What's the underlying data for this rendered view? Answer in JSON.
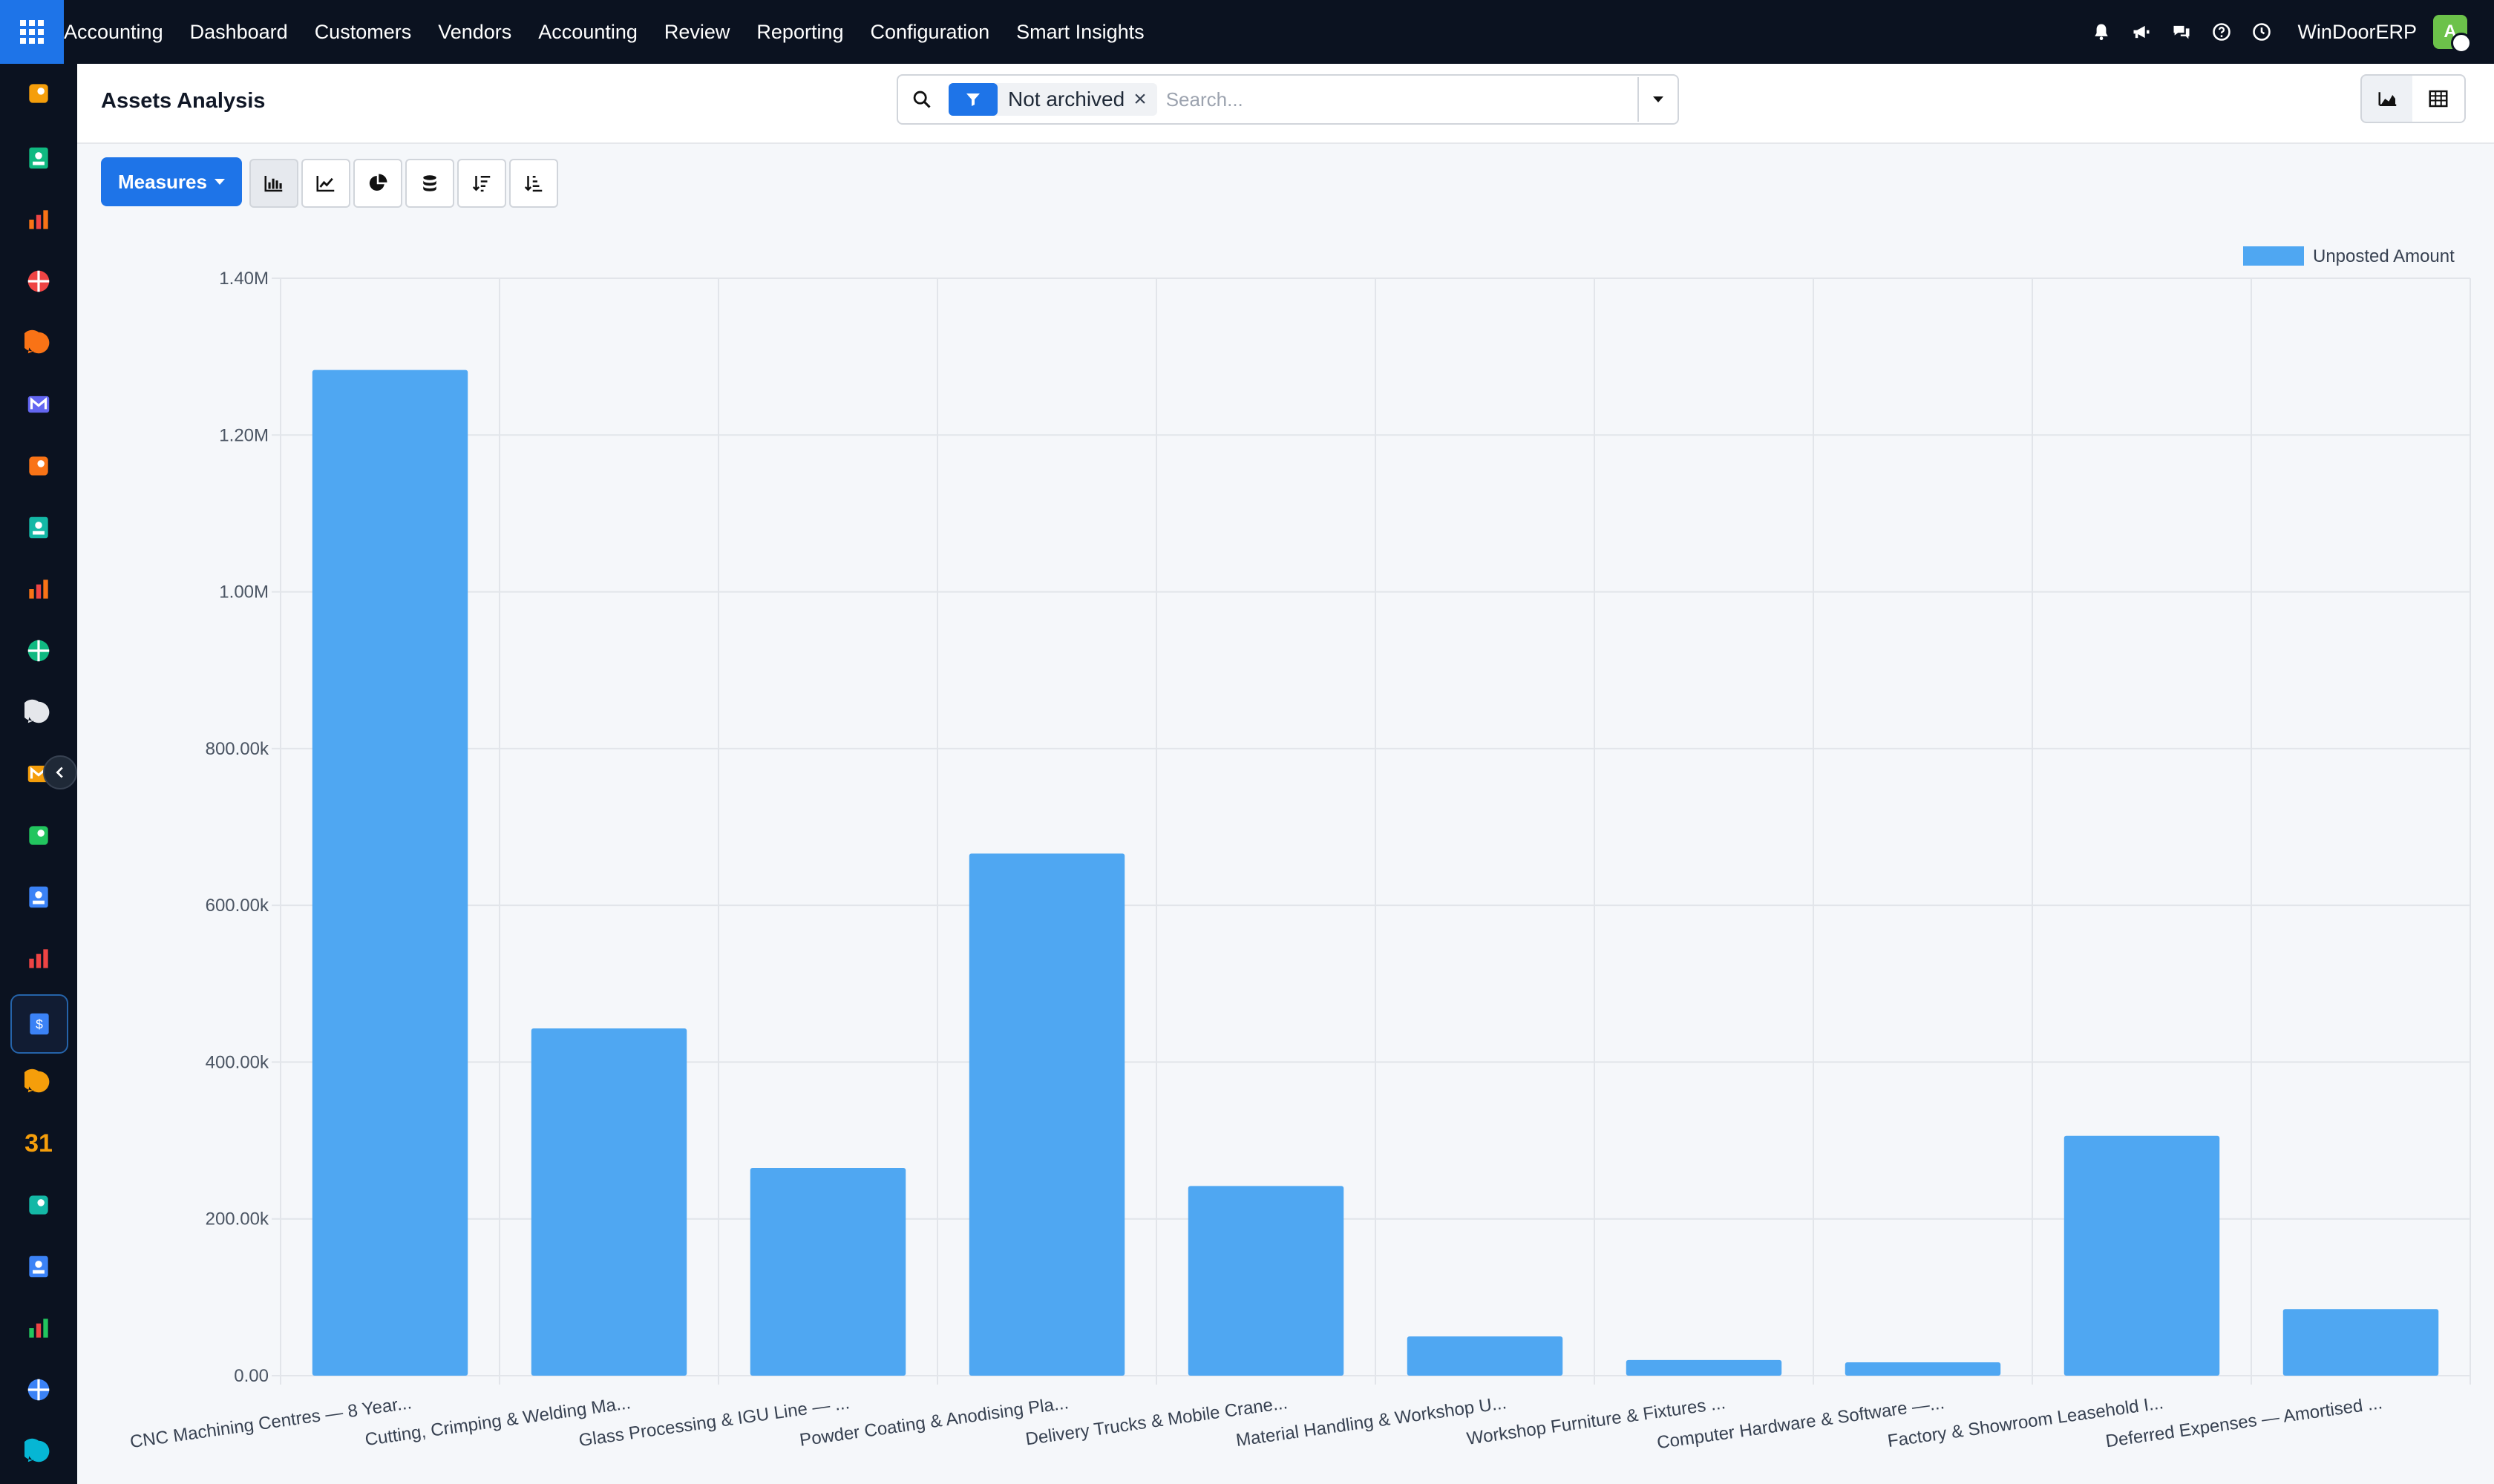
{
  "topbar": {
    "menu": [
      "Accounting",
      "Dashboard",
      "Customers",
      "Vendors",
      "Accounting",
      "Review",
      "Reporting",
      "Configuration",
      "Smart Insights"
    ],
    "company": "WinDoorERP",
    "avatar_letter": "A",
    "icons": [
      "bell-icon",
      "megaphone-icon",
      "chat-icon",
      "help-icon",
      "clock-icon"
    ]
  },
  "rail": {
    "apps": [
      {
        "name": "discuss",
        "color": "#f59e0b"
      },
      {
        "name": "contacts",
        "color": "#10b981"
      },
      {
        "name": "reporting",
        "color": "#f97316"
      },
      {
        "name": "analytics",
        "color": "#ef4444"
      },
      {
        "name": "livechat",
        "color": "#f97316"
      },
      {
        "name": "mail",
        "color": "#6366f1"
      },
      {
        "name": "helpdesk",
        "color": "#f97316"
      },
      {
        "name": "sign",
        "color": "#14b8a6"
      },
      {
        "name": "spreadsheet",
        "color": "#f97316"
      },
      {
        "name": "employees",
        "color": "#10b981"
      },
      {
        "name": "inventory",
        "color": "#e5e7eb"
      },
      {
        "name": "planning",
        "color": "#f59e0b"
      },
      {
        "name": "project",
        "color": "#22c55e"
      },
      {
        "name": "knowledge",
        "color": "#3b82f6"
      },
      {
        "name": "purchase",
        "color": "#ef4444"
      },
      {
        "name": "accounting",
        "color": "#3b82f6"
      },
      {
        "name": "crm",
        "color": "#f59e0b"
      },
      {
        "name": "calendar",
        "label": "31",
        "color": "#f59e0b"
      },
      {
        "name": "studio",
        "color": "#14b8a6"
      },
      {
        "name": "dashboards",
        "color": "#3b82f6"
      },
      {
        "name": "whatsapp",
        "color": "#22c55e"
      },
      {
        "name": "timer",
        "color": "#3b82f6"
      },
      {
        "name": "website",
        "color": "#06b6d4"
      }
    ]
  },
  "page": {
    "title": "Assets Analysis",
    "facet_label": "Not archived",
    "search_placeholder": "Search..."
  },
  "toolbar": {
    "measures_label": "Measures",
    "tools": [
      "bar-chart-icon",
      "line-chart-icon",
      "pie-chart-icon",
      "stacked-icon",
      "sort-desc-icon",
      "sort-asc-icon"
    ]
  },
  "colors": {
    "bar": "#4fa7f2",
    "primary": "#1e74e8",
    "grid": "#e2e5ea"
  },
  "chart_data": {
    "type": "bar",
    "categories": [
      "CNC Machining Centres — 8 Year...",
      "Cutting, Crimping & Welding Ma...",
      "Glass Processing & IGU Line — ...",
      "Powder Coating & Anodising Pla...",
      "Delivery Trucks & Mobile Crane...",
      "Material Handling & Workshop U...",
      "Workshop Furniture & Fixtures ...",
      "Computer Hardware & Software —...",
      "Factory & Showroom Leasehold I...",
      "Deferred Expenses — Amortised ..."
    ],
    "series": [
      {
        "name": "Unposted Amount",
        "values": [
          1283000,
          443000,
          265000,
          666000,
          242000,
          50000,
          20000,
          17000,
          306000,
          85000
        ]
      }
    ],
    "ylim": [
      0,
      1400000
    ],
    "yticks": [
      "0.00",
      "200.00k",
      "400.00k",
      "600.00k",
      "800.00k",
      "1.00M",
      "1.20M",
      "1.40M"
    ],
    "legend_position": "top-right",
    "grid": true
  }
}
